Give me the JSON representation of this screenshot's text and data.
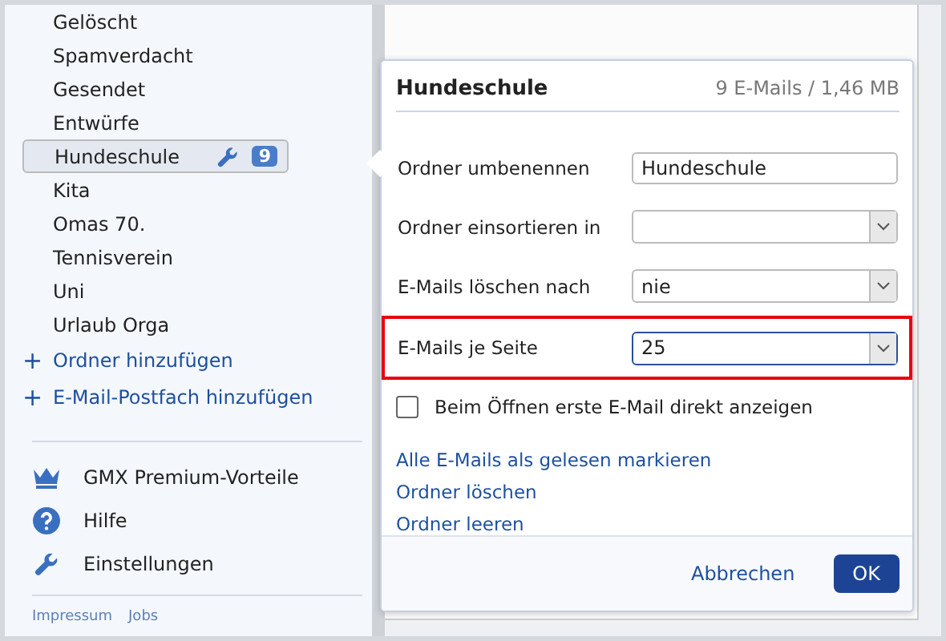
{
  "sidebar": {
    "folders": [
      {
        "label": "Gelöscht",
        "selected": false
      },
      {
        "label": "Spamverdacht",
        "selected": false
      },
      {
        "label": "Gesendet",
        "selected": false
      },
      {
        "label": "Entwürfe",
        "selected": false
      },
      {
        "label": "Hundeschule",
        "selected": true,
        "count": "9"
      },
      {
        "label": "Kita",
        "selected": false
      },
      {
        "label": "Omas 70.",
        "selected": false
      },
      {
        "label": "Tennisverein",
        "selected": false
      },
      {
        "label": "Uni",
        "selected": false
      },
      {
        "label": "Urlaub Orga",
        "selected": false
      }
    ],
    "actions": [
      {
        "icon": "+",
        "label": "Ordner hinzufügen"
      },
      {
        "icon": "+",
        "label": "E-Mail-Postfach hinzufügen"
      }
    ],
    "menu": [
      {
        "kind": "crown",
        "label": "GMX Premium-Vorteile"
      },
      {
        "kind": "help",
        "label": "Hilfe"
      },
      {
        "kind": "wrench",
        "label": "Einstellungen"
      }
    ],
    "footer_links": [
      "Impressum",
      "Jobs"
    ]
  },
  "dialog": {
    "title": "Hundeschule",
    "info": "9 E-Mails / 1,46 MB",
    "fields": [
      {
        "label": "Ordner umbenennen",
        "kind": "text",
        "value": "Hundeschule",
        "highlighted": false
      },
      {
        "label": "Ordner einsortieren in",
        "kind": "select",
        "highlighted": false
      },
      {
        "label": "E-Mails löschen nach",
        "kind": "select",
        "value": "nie",
        "highlighted": false
      },
      {
        "label": "E-Mails je Seite",
        "kind": "select",
        "value": "25",
        "highlighted": true
      }
    ],
    "checkbox": {
      "label": "Beim Öffnen erste E-Mail direkt anzeigen",
      "checked": false
    },
    "links": [
      "Alle E-Mails als gelesen markieren",
      "Ordner löschen",
      "Ordner leeren"
    ],
    "buttons": [
      {
        "label": "Abbrechen",
        "primary": false
      },
      {
        "label": "OK",
        "primary": true
      }
    ]
  }
}
